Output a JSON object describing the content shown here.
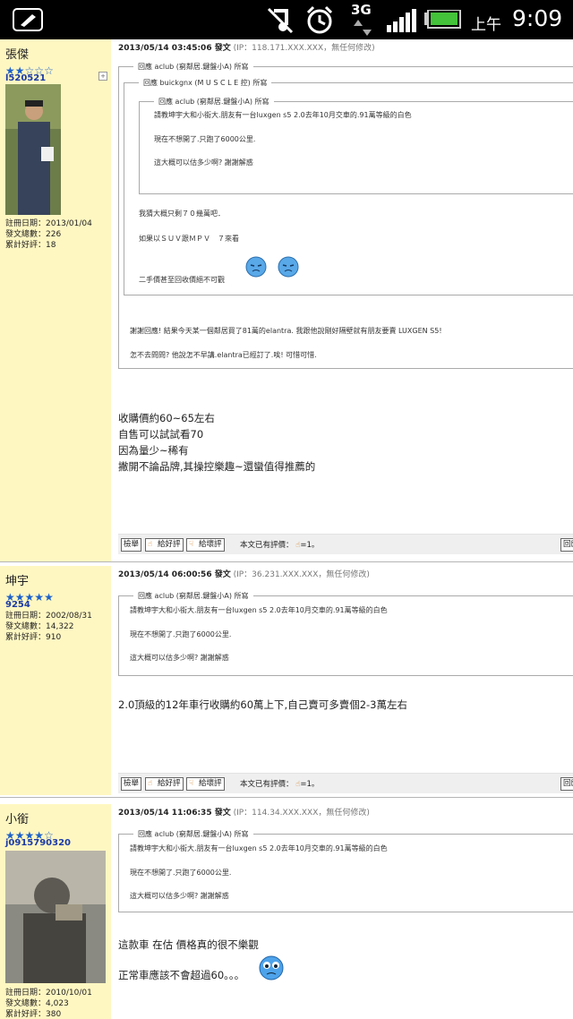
{
  "status_bar": {
    "time": "9:09",
    "ampm": "上午",
    "network": "3G",
    "icons": [
      "app-notification-icon",
      "music-muted-icon",
      "alarm-icon",
      "3g-data-icon",
      "signal-icon",
      "battery-icon"
    ],
    "battery_color": "#44c23a"
  },
  "posts": [
    {
      "user": {
        "name": "張傑",
        "stars": 2,
        "uid": "l520521",
        "register": "註冊日期：2013/01/04",
        "post_count": "發文總數：226",
        "rating": "累計好評：18"
      },
      "meta": {
        "date": "2013/05/14 03:45:06 發文",
        "ip": "(IP：118.171.XXX.XXX，無任何修改)"
      },
      "quotes": {
        "outer_title": "回應 aclub (窮鄰居.鍵盤小A) 所寫",
        "middle_title": "回應 buickgnx (M U S C L E 控) 所寫",
        "inner_title": "回應 aclub (窮鄰居.鍵盤小A) 所寫",
        "inner_lines": [
          "請教坤宇大和小銜大.朋友有一台luxgen s5 2.0去年10月交車的.91萬等級的白色",
          "現在不想開了.只跑了6000公里.",
          "這大概可以估多少啊? 謝謝解惑"
        ],
        "middle_lines": [
          "我猜大概只剩７０幾萬吧．",
          "如果以ＳＵＶ跟ＭＰＶ　７來看",
          "二手價甚至回收價絕不可觀"
        ],
        "outer_lines": [
          "謝謝回應! 結果今天某一個鄰居買了81萬的elantra. 我跟他說剛好隔壁就有朋友要賣 LUXGEN S5!",
          "怎不去問問? 他說怎不早講.elantra已經訂了.唉! 可惜可惜."
        ]
      },
      "body": [
        "收購價約60~65左右",
        "自售可以試試看70",
        "因為量少~稀有",
        "撇開不論品牌,其操控樂趣~還蠻值得推薦的"
      ],
      "actions": {
        "report": "檢舉",
        "good": "給好評",
        "bad": "給壞評",
        "rating_text": "本文已有評價：",
        "rating_value": "=1。",
        "reply": "回應"
      }
    },
    {
      "user": {
        "name": "坤宇",
        "stars": 5,
        "uid": "9254",
        "register": "註冊日期：2002/08/31",
        "post_count": "發文總數：14,322",
        "rating": "累計好評：910"
      },
      "meta": {
        "date": "2013/05/14 06:00:56 發文",
        "ip": "(IP：36.231.XXX.XXX，無任何修改)"
      },
      "quotes": {
        "title": "回應 aclub (窮鄰居.鍵盤小A) 所寫",
        "lines": [
          "請教坤宇大和小銜大.朋友有一台luxgen s5 2.0去年10月交車的.91萬等級的白色",
          "現在不想開了.只跑了6000公里.",
          "這大概可以估多少啊? 謝謝解惑"
        ]
      },
      "body": [
        "2.0頂級的12年車行收購約60萬上下,自己賣可多賣個2-3萬左右"
      ],
      "actions": {
        "report": "檢舉",
        "good": "給好評",
        "bad": "給壞評",
        "rating_text": "本文已有評價：",
        "rating_value": "=1。",
        "reply": "回應"
      }
    },
    {
      "user": {
        "name": "小銜",
        "stars": 4,
        "uid": "j0915790320",
        "register": "註冊日期：2010/10/01",
        "post_count": "發文總數：4,023",
        "rating": "累計好評：380"
      },
      "meta": {
        "date": "2013/05/14 11:06:35 發文",
        "ip": "(IP：114.34.XXX.XXX，無任何修改)"
      },
      "quotes": {
        "title": "回應 aclub (窮鄰居.鍵盤小A) 所寫",
        "lines": [
          "請教坤宇大和小銜大.朋友有一台luxgen s5 2.0去年10月交車的.91萬等級的白色",
          "現在不想開了.只跑了6000公里.",
          "這大概可以估多少啊? 謝謝解惑"
        ]
      },
      "body": [
        "這款車 在估 價格真的很不樂觀",
        "正常車應該不會超過60。。。"
      ]
    }
  ]
}
